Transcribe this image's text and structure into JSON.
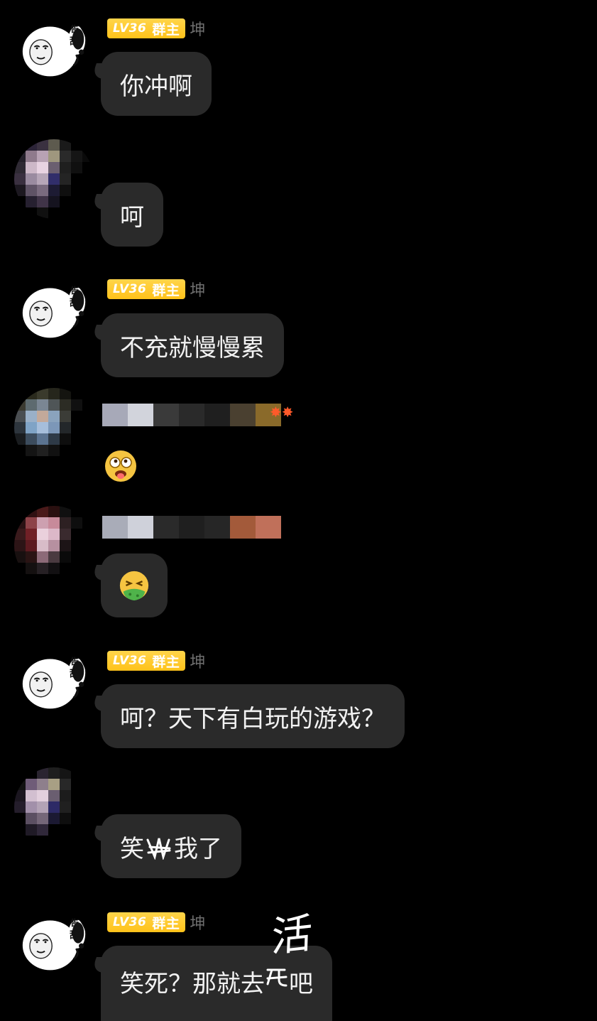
{
  "owner": {
    "level": "LV36",
    "role": "群主",
    "nickname": "坤"
  },
  "messages": [
    {
      "id": 1,
      "text": "你冲啊"
    },
    {
      "id": 2,
      "text": "呵"
    },
    {
      "id": 3,
      "text": "不充就慢慢累"
    },
    {
      "id": 4,
      "emoji": "drooling-eyes-emoji"
    },
    {
      "id": 5,
      "emoji": "nauseated-face-emoji"
    },
    {
      "id": 6,
      "text": "呵？天下有白玩的游戏？"
    },
    {
      "id": 7,
      "text_before": "笑",
      "text_after": "我了"
    },
    {
      "id": 8,
      "text_before": "笑死？那就去",
      "text_after": "吧",
      "overwritten_text": "活"
    }
  ],
  "colors": {
    "background": "#000000",
    "bubble": "#2a2a2a",
    "badge": "#ffc21a",
    "nickname": "#6e6e6e"
  }
}
